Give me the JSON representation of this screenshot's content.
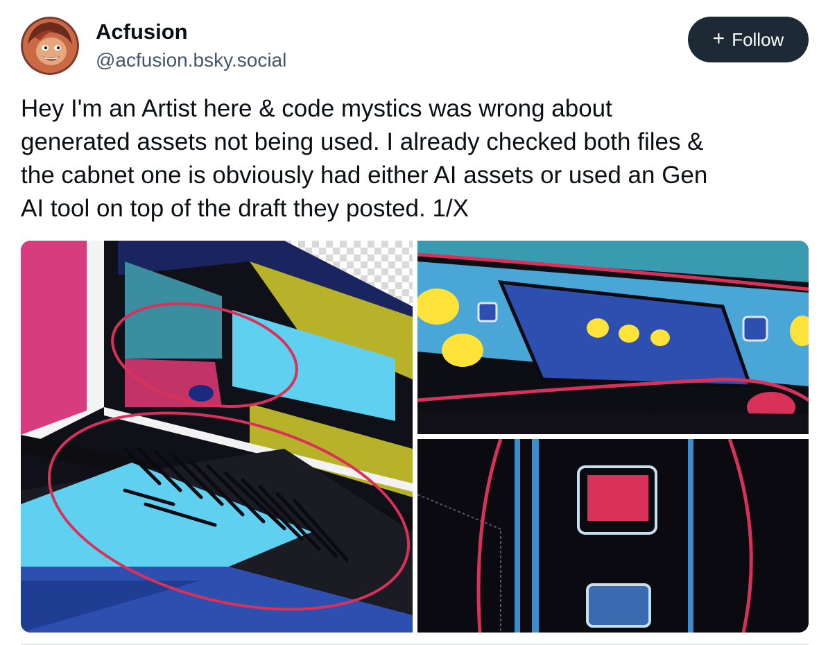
{
  "author": {
    "display_name": "Acfusion",
    "handle": "@acfusion.bsky.social",
    "avatar_icon": "avatar-image"
  },
  "follow_button": {
    "icon": "+",
    "label": "Follow"
  },
  "post": {
    "text": "Hey I'm an Artist here & code mystics was wrong about\ngenerated assets not being used. I already checked both files &\nthe cabnet one is obviously had either AI assets or used an Gen\nAI tool on top of the draft they posted. 1/X"
  },
  "colors": {
    "follow_bg": "#1e2936",
    "handle": "#42576c",
    "annotation_red": "#d8325a",
    "cyan": "#5fd0ef",
    "magenta": "#d63c7e",
    "olive": "#b8b22a",
    "panel_blue": "#2c4fb0"
  }
}
